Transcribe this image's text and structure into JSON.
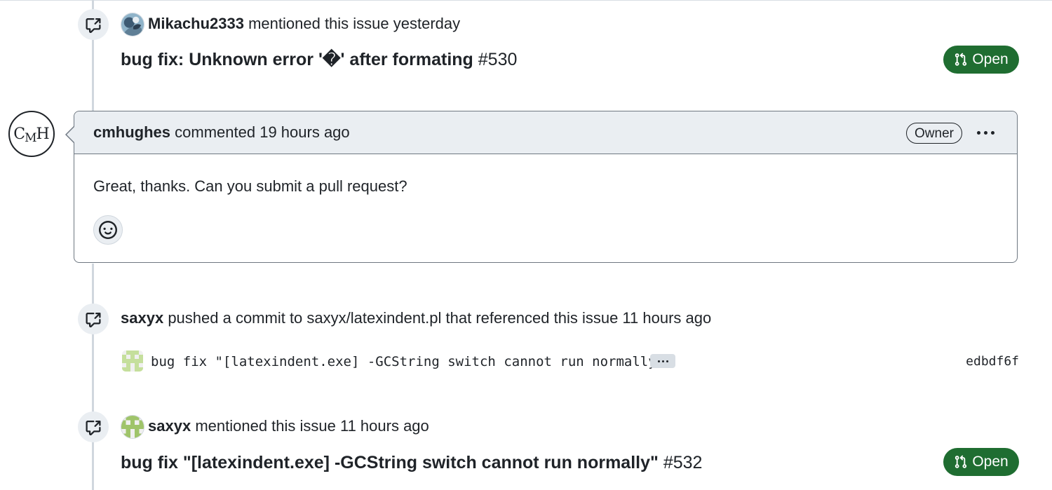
{
  "events": [
    {
      "actor": "Mikachu2333",
      "action": "mentioned this issue yesterday",
      "ref_title": "bug fix: Unknown error '�' after formating",
      "ref_number": "#530",
      "state": "Open"
    },
    {
      "actor": "saxyx",
      "action": "pushed a commit to saxyx/latexindent.pl that referenced this issue 11 hours ago",
      "commit_message": "bug fix \"[latexindent.exe] -GCString switch cannot run normally\"",
      "commit_sha": "edbdf6f"
    },
    {
      "actor": "saxyx",
      "action": "mentioned this issue 11 hours ago",
      "ref_title": "bug fix \"[latexindent.exe] -GCString switch cannot run normally\"",
      "ref_number": "#532",
      "state": "Open"
    }
  ],
  "comment": {
    "avatar_text_c": "C",
    "avatar_text_m": "M",
    "avatar_text_h": "H",
    "author": "cmhughes",
    "meta": "commented 19 hours ago",
    "role_label": "Owner",
    "body": "Great, thanks. Can you submit a pull request?"
  },
  "icons": {
    "cross_reference": "cross-reference-icon",
    "pull_request": "git-pull-request-icon",
    "smiley": "smiley-icon",
    "kebab": "kebab-horizontal-icon"
  },
  "colors": {
    "open_state": "#1f6d31",
    "timeline": "#d0d7de",
    "header_bg": "#eaeef2"
  }
}
